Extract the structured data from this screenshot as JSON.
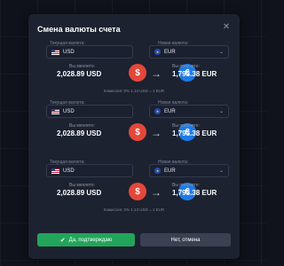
{
  "modal": {
    "title": "Смена валюты счета",
    "close_icon": "close-icon"
  },
  "blocks": [
    {
      "current_label": "Текущая валюта:",
      "current_value": "USD",
      "new_label": "Новая валюта:",
      "new_value": "EUR",
      "you_pay_label": "Вы меняете:",
      "you_pay": "2,028.89 USD",
      "you_get_label": "Вы получите:",
      "you_get": "1,793.38 EUR",
      "commission": "Комиссия: 0% 1.13 USD = 1 EUR"
    },
    {
      "current_label": "Текущая валюта:",
      "current_value": "USD",
      "new_label": "Новая валюта:",
      "new_value": "EUR",
      "you_pay_label": "Вы меняете:",
      "you_pay": "2,028.89 USD",
      "you_get_label": "Вы получите:",
      "you_get": "1,793.38 EUR",
      "commission": ""
    },
    {
      "current_label": "Текущая валюта:",
      "current_value": "USD",
      "new_label": "Новая валюта:",
      "new_value": "EUR",
      "you_pay_label": "Вы меняете:",
      "you_pay": "2,028.89 USD",
      "you_get_label": "Вы получите:",
      "you_get": "1,793.38 EUR",
      "commission": "Комиссия: 0% 1.13 USD = 1 EUR"
    }
  ],
  "buttons": {
    "confirm": "Да, подтверждаю",
    "cancel": "Нет, отмена"
  },
  "colors": {
    "confirm": "#22a55a",
    "usd_coin": "#e5473a",
    "eur_coin": "#1e7ae6"
  }
}
